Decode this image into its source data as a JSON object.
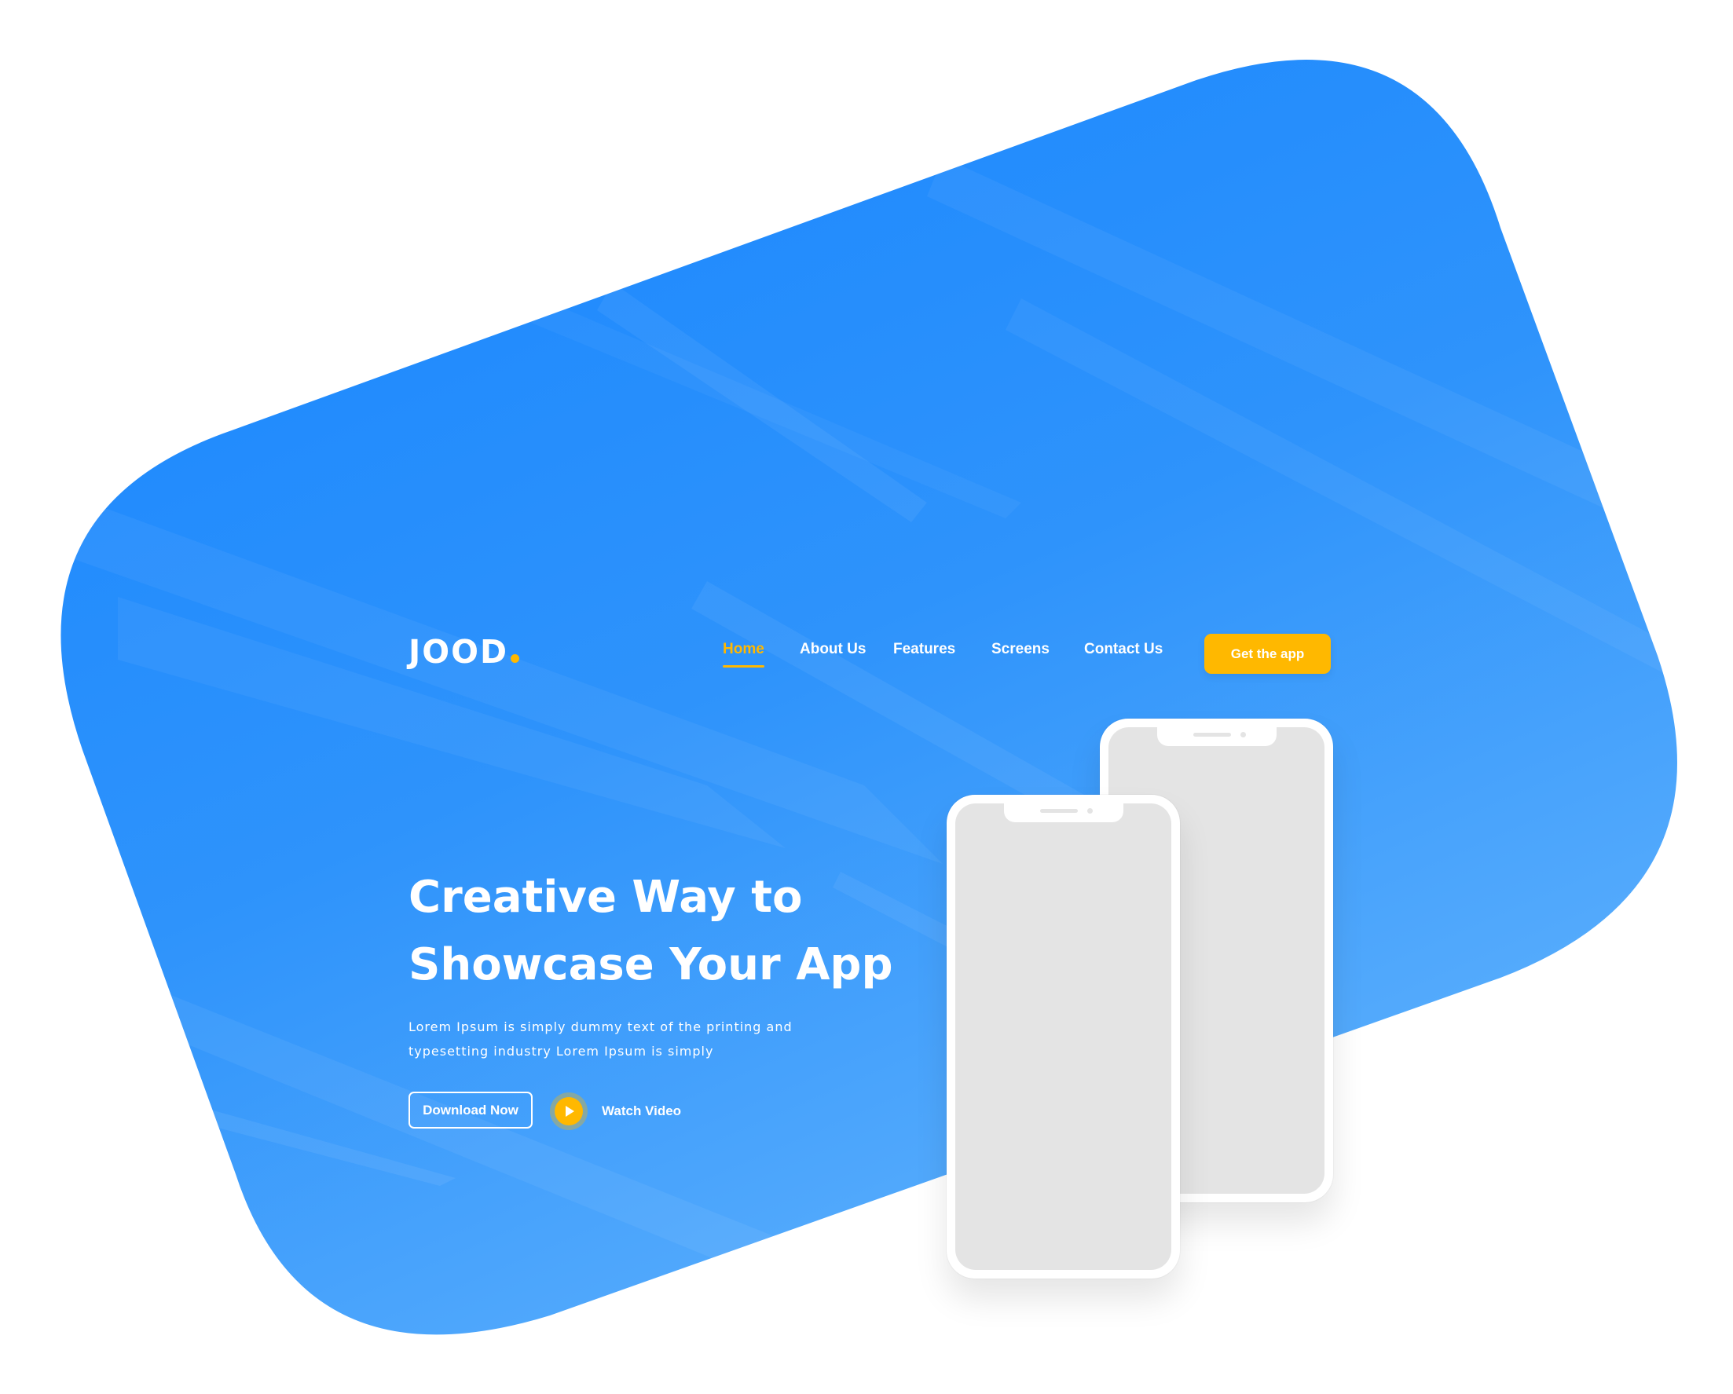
{
  "brand": {
    "logo_text": "JOOD",
    "accent_color": "#ffb800",
    "hero_color": "#1a88ff"
  },
  "nav": {
    "items": [
      {
        "label": "Home",
        "active": true
      },
      {
        "label": "About Us",
        "active": false
      },
      {
        "label": "Features",
        "active": false
      },
      {
        "label": "Screens",
        "active": false
      },
      {
        "label": "Contact Us",
        "active": false
      }
    ],
    "cta_label": "Get the app"
  },
  "hero": {
    "title_lines": [
      "Creative Way to",
      "Showcase Your App"
    ],
    "text_lines": [
      "Lorem Ipsum is simply dummy text of the printing and",
      "typesetting industry Lorem Ipsum is simply"
    ],
    "download_label": "Download Now",
    "watch_label": "Watch Video",
    "play_icon": "play-icon"
  }
}
